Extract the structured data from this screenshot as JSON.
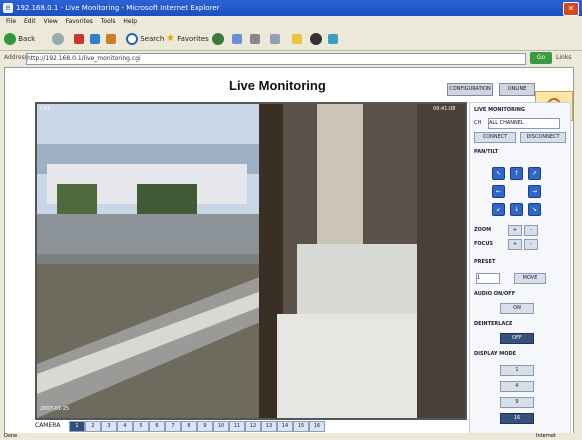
{
  "window": {
    "title": "192.168.0.1 - Live Monitoring - Microsoft Internet Explorer",
    "close_glyph": "✕",
    "icon": "ie-icon"
  },
  "menu": [
    "File",
    "Edit",
    "View",
    "Favorites",
    "Tools",
    "Help"
  ],
  "toolbar": {
    "back_label": "Back",
    "search_label": "Search",
    "favorites_label": "Favorites"
  },
  "address": {
    "label": "Address",
    "value": "http://192.168.0.1/live_monitoring.cgi",
    "go_label": "Go",
    "links_label": "Links"
  },
  "page": {
    "title": "Live Monitoring",
    "top_buttons": [
      "CONFIGURATION",
      "ONLINE"
    ],
    "video": {
      "osd_top_left": "CH1",
      "osd_top_right": "09:41:08",
      "osd_bottom_left": "2007-01-25"
    },
    "camera_bar": {
      "label": "CAMERA",
      "buttons": [
        "1",
        "2",
        "3",
        "4",
        "5",
        "6",
        "7",
        "8",
        "9",
        "10",
        "11",
        "12",
        "13",
        "14",
        "15",
        "16"
      ]
    },
    "panel": {
      "live_monitoring_title": "LIVE MONITORING",
      "channel_label": "CH",
      "channel_value": "ALL CHANNEL",
      "connect_label": "CONNECT",
      "disconnect_label": "DISCONNECT",
      "pan_tilt_title": "PAN/TILT",
      "zoom_label": "ZOOM",
      "focus_label": "FOCUS",
      "plus": "+",
      "minus": "-",
      "preset_title": "PRESET",
      "preset_value": "1",
      "move_label": "MOVE",
      "audio_title": "AUDIO ON/OFF",
      "audio_value": "ON",
      "deinterlace_title": "DEINTERLACE",
      "deinterlace_value": "OFF",
      "display_mode_title": "DISPLAY MODE",
      "display_modes": [
        "1",
        "4",
        "9",
        "16"
      ]
    }
  },
  "status": {
    "left": "Done",
    "right": "Internet"
  }
}
